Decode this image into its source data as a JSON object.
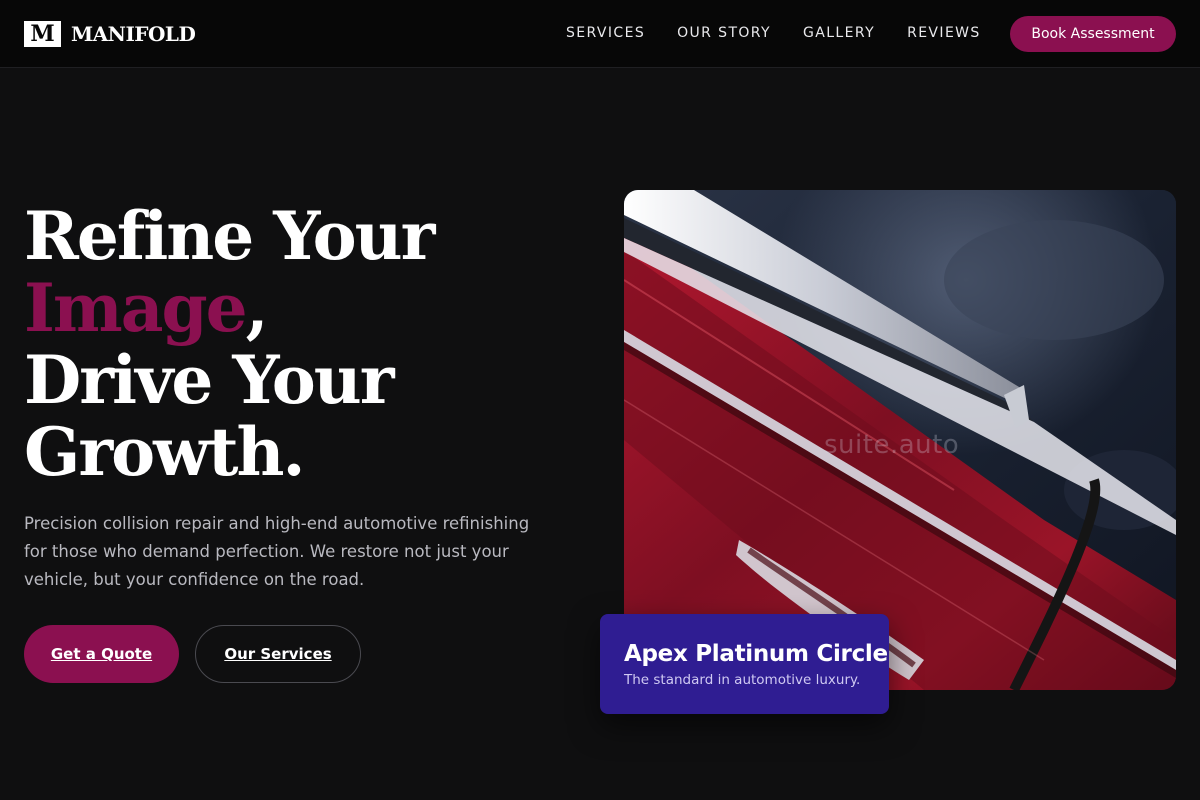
{
  "header": {
    "logo_mark": "M",
    "logo_text": "MANIFOLD",
    "nav": [
      "SERVICES",
      "OUR STORY",
      "GALLERY",
      "REVIEWS"
    ],
    "cta_label": "Book Assessment"
  },
  "hero": {
    "headline_line1": "Refine Your",
    "headline_accent": "Image",
    "headline_comma": ",",
    "headline_line3": "Drive Your",
    "headline_line4": "Growth.",
    "subcopy": "Precision collision repair and high-end automotive refinishing for those who demand perfection. We restore not just your vehicle, but your confidence on the road.",
    "primary_button": "Get a Quote",
    "secondary_button": "Our Services"
  },
  "image": {
    "watermark": "suite.auto",
    "subject_icon": "car-door-photo"
  },
  "card": {
    "title": "Apex Platinum Circle",
    "subtitle": "The standard in automotive luxury."
  },
  "colors": {
    "background": "#0f0f10",
    "header_bg": "#070707",
    "accent": "#8b1050",
    "card_bg": "#2f1d92",
    "car_red": "#8e1226"
  }
}
